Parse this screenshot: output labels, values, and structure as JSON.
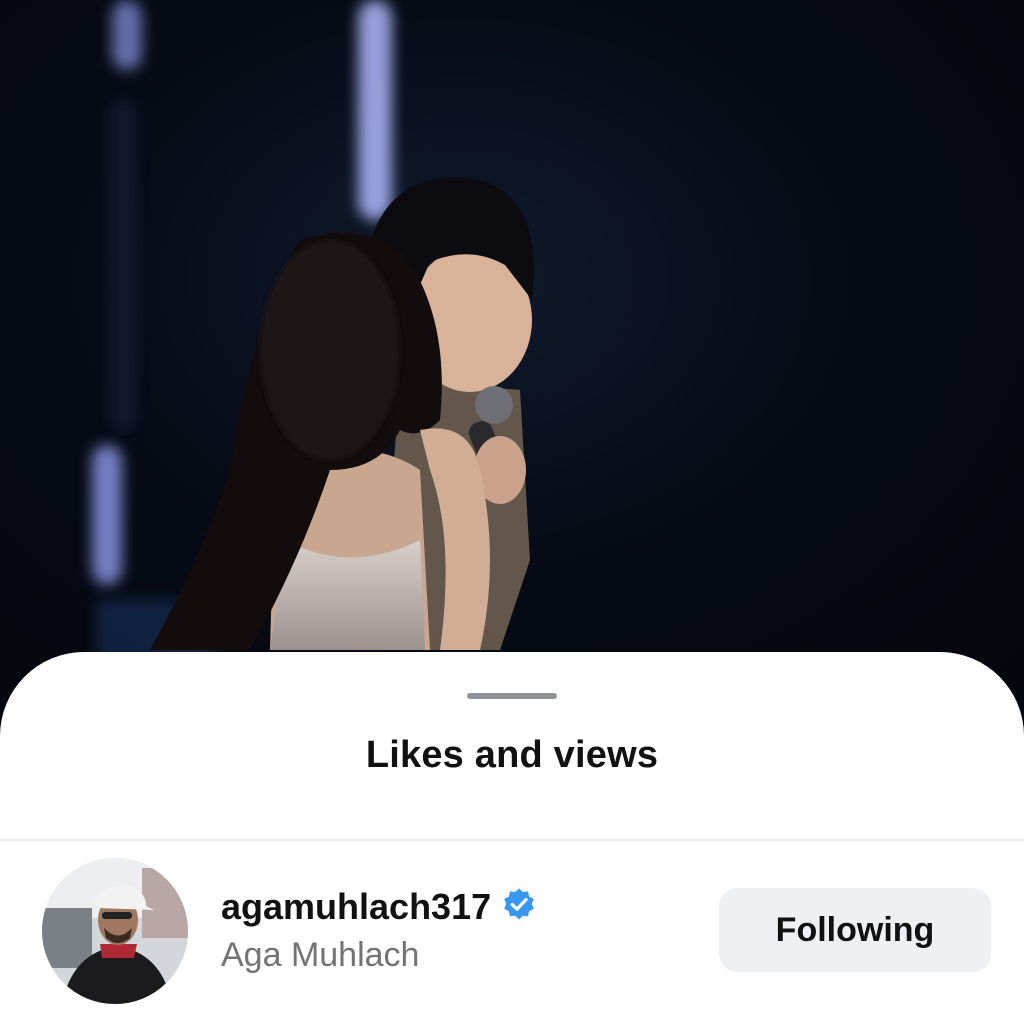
{
  "sheet": {
    "title": "Likes and views"
  },
  "user": {
    "username": "agamuhlach317",
    "full_name": "Aga Muhlach",
    "verified": true,
    "follow_button_label": "Following",
    "avatar_icon": "profile-photo",
    "verified_icon": "verified-badge-icon"
  },
  "colors": {
    "sheet_background": "#ffffff",
    "button_background": "#eff0f3",
    "verified_blue": "#3897f0",
    "secondary_text": "#737373"
  }
}
